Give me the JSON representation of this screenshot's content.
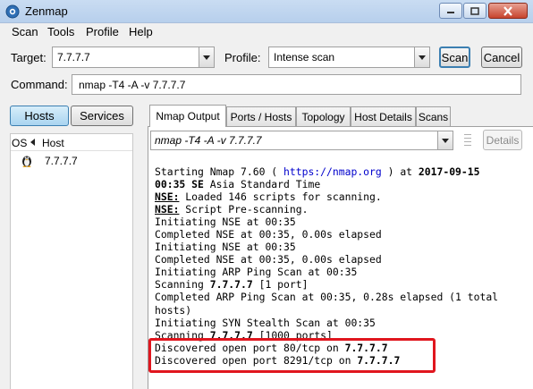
{
  "window": {
    "title": "Zenmap"
  },
  "menu": {
    "items": [
      "Scan",
      "Tools",
      "Profile",
      "Help"
    ]
  },
  "target": {
    "label": "Target:",
    "value": "7.7.7.7"
  },
  "profile": {
    "label": "Profile:",
    "value": "Intense scan"
  },
  "buttons": {
    "scan": "Scan",
    "cancel": "Cancel",
    "details": "Details",
    "hosts": "Hosts",
    "services": "Services"
  },
  "command": {
    "label": "Command:",
    "value": "nmap -T4 -A -v 7.7.7.7"
  },
  "host_list": {
    "col_os": "OS",
    "col_host": "Host",
    "hosts": [
      {
        "os_icon": "linux-penguin-icon",
        "address": "7.7.7.7"
      }
    ]
  },
  "tabs": [
    "Nmap Output",
    "Ports / Hosts",
    "Topology",
    "Host Details",
    "Scans"
  ],
  "output_selector": {
    "value": "nmap -T4 -A -v 7.7.7.7"
  },
  "output": {
    "lines": [
      [
        {
          "t": "Starting Nmap 7.60 ( "
        },
        {
          "t": "https://nmap.org",
          "s": "url"
        },
        {
          "t": " ) at "
        },
        {
          "t": "2017-09-15",
          "s": "b"
        }
      ],
      [
        {
          "t": "00:35 SE",
          "s": "b"
        },
        {
          "t": " Asia Standard Time"
        }
      ],
      [
        {
          "t": "NSE:",
          "s": "u"
        },
        {
          "t": " Loaded 146 scripts for scanning."
        }
      ],
      [
        {
          "t": "NSE:",
          "s": "u"
        },
        {
          "t": " Script Pre-scanning."
        }
      ],
      [
        {
          "t": "Initiating NSE at 00:35"
        }
      ],
      [
        {
          "t": "Completed NSE at 00:35, 0.00s elapsed"
        }
      ],
      [
        {
          "t": "Initiating NSE at 00:35"
        }
      ],
      [
        {
          "t": "Completed NSE at 00:35, 0.00s elapsed"
        }
      ],
      [
        {
          "t": "Initiating ARP Ping Scan at 00:35"
        }
      ],
      [
        {
          "t": "Scanning "
        },
        {
          "t": "7.7.7.7",
          "s": "b"
        },
        {
          "t": " [1 port]"
        }
      ],
      [
        {
          "t": "Completed ARP Ping Scan at 00:35, 0.28s elapsed (1 total"
        }
      ],
      [
        {
          "t": "hosts)"
        }
      ],
      [
        {
          "t": "Initiating SYN Stealth Scan at 00:35"
        }
      ],
      [
        {
          "t": "Scanning "
        },
        {
          "t": "7.7.7.7",
          "s": "b"
        },
        {
          "t": " [1000 ports]"
        }
      ],
      [
        {
          "t": "Discovered open port 80/tcp on "
        },
        {
          "t": "7.7.7.7",
          "s": "b"
        }
      ],
      [
        {
          "t": "Discovered open port 8291/tcp on "
        },
        {
          "t": "7.7.7.7",
          "s": "b"
        }
      ]
    ]
  },
  "colors": {
    "highlight": "#e0161e",
    "url": "#0000cc",
    "selected_button": "#a9d4f0"
  }
}
